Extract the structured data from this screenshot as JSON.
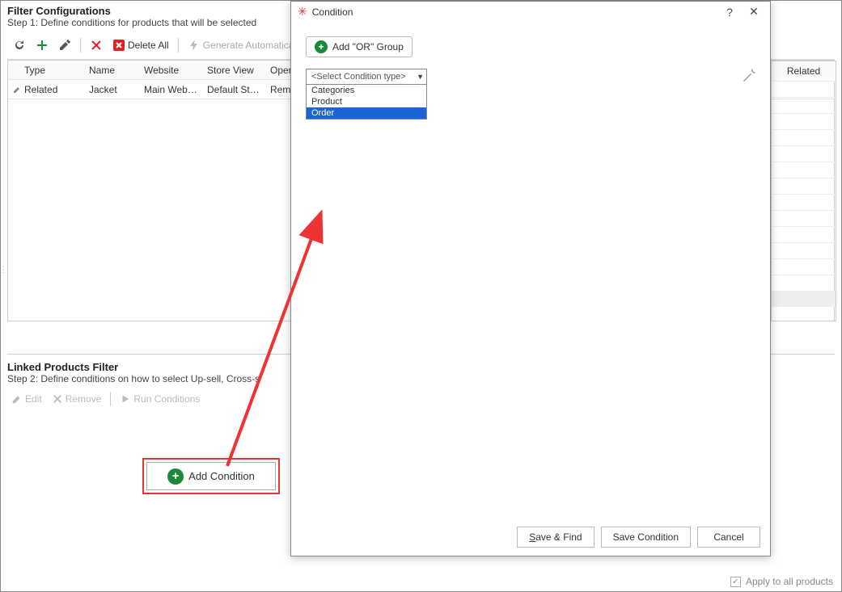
{
  "filter_config": {
    "title": "Filter Configurations",
    "subtitle": "Step 1: Define conditions for products that will be selected",
    "toolbar": {
      "delete_all": "Delete All",
      "generate": "Generate Automatically"
    },
    "table": {
      "headers": {
        "type": "Type",
        "name": "Name",
        "website": "Website",
        "store_view": "Store View",
        "operation": "Oper"
      },
      "rows": [
        {
          "type": "Related",
          "name": "Jacket",
          "website": "Main Website",
          "store_view": "Default Stor...",
          "operation": "Remo..."
        }
      ]
    }
  },
  "linked": {
    "title": "Linked Products Filter",
    "subtitle": "Step 2: Define conditions on how to select Up-sell, Cross-s",
    "toolbar": {
      "edit": "Edit",
      "remove": "Remove",
      "run": "Run Conditions"
    },
    "add_condition": "Add Condition"
  },
  "related_panel": {
    "header": "Related"
  },
  "bottom": {
    "apply_all": "Apply to all products"
  },
  "modal": {
    "title": "Condition",
    "add_or": "Add \"OR\" Group",
    "select_placeholder": "<Select Condition type>",
    "options": {
      "categories": "Categories",
      "product": "Product",
      "order": "Order"
    },
    "buttons": {
      "save_find": "Save & Find",
      "save_cond": "Save Condition",
      "cancel": "Cancel"
    }
  }
}
